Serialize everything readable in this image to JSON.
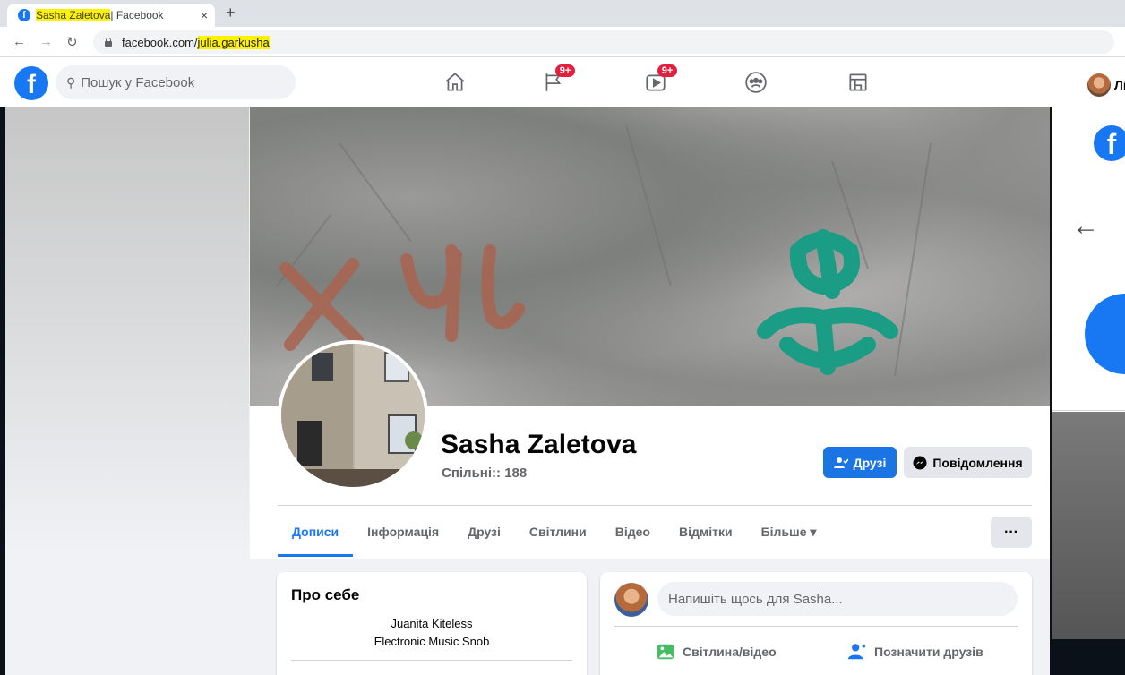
{
  "browser": {
    "tab_title_highlight": "Sasha Zaletova",
    "tab_title_rest": " | Facebook",
    "tab_close": "×",
    "new_tab": "+",
    "url_plain": "facebook.com/",
    "url_highlight": "julia.garkusha"
  },
  "header": {
    "logo": "f",
    "search_placeholder": "Пошук у Facebook",
    "nav": [
      {
        "name": "home-icon",
        "badge": ""
      },
      {
        "name": "pages-icon",
        "badge": "9+"
      },
      {
        "name": "watch-icon",
        "badge": "9+"
      },
      {
        "name": "groups-icon",
        "badge": ""
      },
      {
        "name": "gaming-icon",
        "badge": ""
      }
    ],
    "user_name": "Ліна"
  },
  "profile": {
    "name": "Sasha Zaletova",
    "mutual": "Спільні:: 188",
    "friends_button": "Друзі",
    "message_button": "Повідомлення",
    "tabs": [
      "Дописи",
      "Інформація",
      "Друзі",
      "Світлини",
      "Відео",
      "Відмітки",
      "Більше ▾"
    ],
    "active_tab": 0,
    "more_button": "···"
  },
  "about": {
    "title": "Про себе",
    "lines": [
      "Juanita Kiteless",
      "Electronic Music Snob"
    ]
  },
  "composer": {
    "placeholder": "Напишіть щось для Sasha...",
    "photo_action": "Світлина/відео",
    "tag_action": "Позначити друзів"
  },
  "colors": {
    "brand": "#1877f2",
    "badge": "#e41e3f",
    "highlight": "#fff200"
  }
}
